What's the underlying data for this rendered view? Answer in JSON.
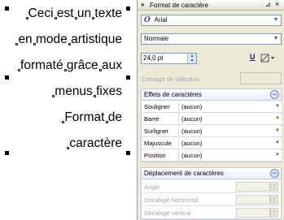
{
  "artistic_text": {
    "lines": [
      [
        "Ceci",
        "est",
        "un",
        "texte"
      ],
      [
        "en",
        "mode",
        "artistique"
      ],
      [
        "formaté",
        "grâce",
        "aux"
      ],
      [
        "menus",
        "fixes"
      ],
      [
        "Format",
        "de"
      ],
      [
        "caractère"
      ]
    ]
  },
  "docker": {
    "collapse_arrows": "»",
    "title": "Format de caractère",
    "pin_glyph": "⊿",
    "close_glyph": "×",
    "font_type_icon": "O",
    "font_name": "Arial",
    "font_style": "Normale",
    "font_size": "24,0 pt",
    "underline_icon": "U",
    "kerning_label": "Crénage de sélection :",
    "effects_section": {
      "title": "Effets de caractères",
      "rows": [
        {
          "label": "Souligner",
          "value": "(aucun)"
        },
        {
          "label": "Barré",
          "value": "(aucun)"
        },
        {
          "label": "Surligner",
          "value": "(aucun)"
        },
        {
          "label": "Majuscule",
          "value": "(aucun)"
        },
        {
          "label": "Position",
          "value": "(aucun)"
        }
      ]
    },
    "shift_section": {
      "title": "Déplacement de caractères",
      "rows": [
        {
          "label": "Angle"
        },
        {
          "label": "Décalage horizontal"
        },
        {
          "label": "Décalage vertical"
        }
      ]
    }
  },
  "icons": {
    "collapse_section": "chevron-up-icon",
    "dropdown": "chevron-down-icon",
    "spinner": "spinner-arrows-icon"
  }
}
